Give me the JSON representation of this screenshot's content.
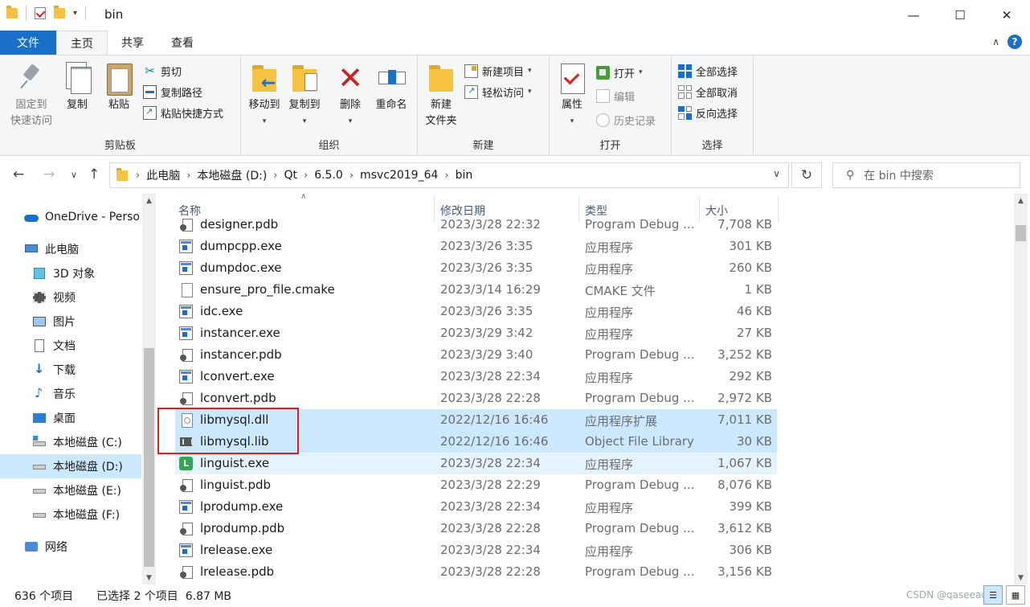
{
  "window": {
    "title": "bin",
    "minimize": "—",
    "maximize": "☐",
    "close": "✕"
  },
  "tabs": {
    "file": "文件",
    "home": "主页",
    "share": "共享",
    "view": "查看",
    "help": "?"
  },
  "ribbon": {
    "clipboard": {
      "label": "剪贴板",
      "pin": "固定到\n快速访问",
      "pin_line1": "固定到",
      "pin_line2": "快速访问",
      "copy": "复制",
      "paste": "粘贴",
      "cut": "剪切",
      "copy_path": "复制路径",
      "paste_shortcut": "粘贴快捷方式"
    },
    "organize": {
      "label": "组织",
      "move_to": "移动到",
      "copy_to": "复制到",
      "delete": "删除",
      "rename": "重命名"
    },
    "new": {
      "label": "新建",
      "new_folder_line1": "新建",
      "new_folder_line2": "文件夹",
      "new_item": "新建项目",
      "easy_access": "轻松访问"
    },
    "open": {
      "label": "打开",
      "properties": "属性",
      "open": "打开",
      "edit": "编辑",
      "history": "历史记录"
    },
    "select": {
      "label": "选择",
      "select_all": "全部选择",
      "select_none": "全部取消",
      "invert": "反向选择"
    }
  },
  "address": {
    "breadcrumbs": [
      "此电脑",
      "本地磁盘 (D:)",
      "Qt",
      "6.5.0",
      "msvc2019_64",
      "bin"
    ],
    "search_placeholder": "在 bin 中搜索"
  },
  "navpane": {
    "items": [
      {
        "label": "OneDrive - Perso",
        "icon": "onedrive-icon"
      },
      {
        "label": "此电脑",
        "icon": "computer-icon"
      },
      {
        "label": "3D 对象",
        "icon": "3d-objects-icon"
      },
      {
        "label": "视频",
        "icon": "video-icon"
      },
      {
        "label": "图片",
        "icon": "pictures-icon"
      },
      {
        "label": "文档",
        "icon": "documents-icon"
      },
      {
        "label": "下载",
        "icon": "download-icon"
      },
      {
        "label": "音乐",
        "icon": "music-icon"
      },
      {
        "label": "桌面",
        "icon": "desktop-icon"
      },
      {
        "label": "本地磁盘 (C:)",
        "icon": "drive-c-icon"
      },
      {
        "label": "本地磁盘 (D:)",
        "icon": "drive-icon"
      },
      {
        "label": "本地磁盘 (E:)",
        "icon": "drive-icon"
      },
      {
        "label": "本地磁盘 (F:)",
        "icon": "drive-icon"
      },
      {
        "label": "网络",
        "icon": "network-icon"
      }
    ],
    "selected_index": 10
  },
  "filelist": {
    "columns": {
      "name": "名称",
      "date": "修改日期",
      "type": "类型",
      "size": "大小"
    },
    "rows": [
      {
        "name": "designer.pdb",
        "date": "2023/3/28 22:32",
        "type": "Program Debug ...",
        "size": "7,708 KB",
        "kind": "pdb",
        "state": ""
      },
      {
        "name": "dumpcpp.exe",
        "date": "2023/3/26 3:35",
        "type": "应用程序",
        "size": "301 KB",
        "kind": "exe",
        "state": ""
      },
      {
        "name": "dumpdoc.exe",
        "date": "2023/3/26 3:35",
        "type": "应用程序",
        "size": "260 KB",
        "kind": "exe",
        "state": ""
      },
      {
        "name": "ensure_pro_file.cmake",
        "date": "2023/3/14 16:29",
        "type": "CMAKE 文件",
        "size": "1 KB",
        "kind": "file",
        "state": ""
      },
      {
        "name": "idc.exe",
        "date": "2023/3/26 3:35",
        "type": "应用程序",
        "size": "46 KB",
        "kind": "exe",
        "state": ""
      },
      {
        "name": "instancer.exe",
        "date": "2023/3/29 3:42",
        "type": "应用程序",
        "size": "27 KB",
        "kind": "exe",
        "state": ""
      },
      {
        "name": "instancer.pdb",
        "date": "2023/3/29 3:40",
        "type": "Program Debug ...",
        "size": "3,252 KB",
        "kind": "pdb",
        "state": ""
      },
      {
        "name": "lconvert.exe",
        "date": "2023/3/28 22:34",
        "type": "应用程序",
        "size": "292 KB",
        "kind": "exe",
        "state": ""
      },
      {
        "name": "lconvert.pdb",
        "date": "2023/3/28 22:28",
        "type": "Program Debug ...",
        "size": "2,972 KB",
        "kind": "pdb",
        "state": ""
      },
      {
        "name": "libmysql.dll",
        "date": "2022/12/16 16:46",
        "type": "应用程序扩展",
        "size": "7,011 KB",
        "kind": "dll",
        "state": "sel"
      },
      {
        "name": "libmysql.lib",
        "date": "2022/12/16 16:46",
        "type": "Object File Library",
        "size": "30 KB",
        "kind": "lib",
        "state": "sel"
      },
      {
        "name": "linguist.exe",
        "date": "2023/3/28 22:34",
        "type": "应用程序",
        "size": "1,067 KB",
        "kind": "ling",
        "state": "hover"
      },
      {
        "name": "linguist.pdb",
        "date": "2023/3/28 22:29",
        "type": "Program Debug ...",
        "size": "8,076 KB",
        "kind": "pdb",
        "state": ""
      },
      {
        "name": "lprodump.exe",
        "date": "2023/3/28 22:34",
        "type": "应用程序",
        "size": "399 KB",
        "kind": "exe",
        "state": ""
      },
      {
        "name": "lprodump.pdb",
        "date": "2023/3/28 22:28",
        "type": "Program Debug ...",
        "size": "3,612 KB",
        "kind": "pdb",
        "state": ""
      },
      {
        "name": "lrelease.exe",
        "date": "2023/3/28 22:34",
        "type": "应用程序",
        "size": "306 KB",
        "kind": "exe",
        "state": ""
      },
      {
        "name": "lrelease.pdb",
        "date": "2023/3/28 22:28",
        "type": "Program Debug ...",
        "size": "3,156 KB",
        "kind": "pdb",
        "state": ""
      }
    ]
  },
  "status": {
    "item_count": "636 个项目",
    "selection": "已选择 2 个项目  6.87 MB",
    "watermark": "CSDN @qaseeac"
  }
}
